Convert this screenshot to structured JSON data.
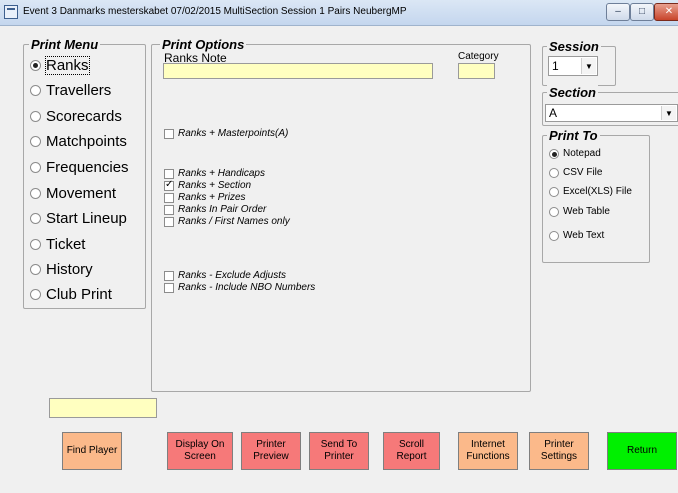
{
  "window": {
    "title": "Event 3   Danmarks mesterskabet 07/02/2015 MultiSection Session 1 Pairs NeubergMP",
    "minimize_glyph": "–",
    "maximize_glyph": "□",
    "close_glyph": "✕"
  },
  "print_menu": {
    "legend": "Print Menu",
    "items": [
      {
        "label": "Ranks",
        "selected": true
      },
      {
        "label": "Travellers",
        "selected": false
      },
      {
        "label": "Scorecards",
        "selected": false
      },
      {
        "label": "Matchpoints",
        "selected": false
      },
      {
        "label": "Frequencies",
        "selected": false
      },
      {
        "label": "Movement",
        "selected": false
      },
      {
        "label": "Start Lineup",
        "selected": false
      },
      {
        "label": "Ticket",
        "selected": false
      },
      {
        "label": "History",
        "selected": false
      },
      {
        "label": "Club Print",
        "selected": false
      }
    ]
  },
  "print_options": {
    "legend": "Print Options",
    "ranks_note_label": "Ranks Note",
    "ranks_note_value": "",
    "category_label": "Category",
    "category_value": "",
    "options": [
      {
        "label": "Ranks + Masterpoints(A)",
        "checked": false
      },
      {
        "label": "Ranks + Handicaps",
        "checked": false
      },
      {
        "label": "Ranks + Section",
        "checked": true
      },
      {
        "label": "Ranks + Prizes",
        "checked": false
      },
      {
        "label": "Ranks In Pair Order",
        "checked": false
      },
      {
        "label": "Ranks / First Names only",
        "checked": false
      },
      {
        "label": "Ranks - Exclude Adjusts",
        "checked": false
      },
      {
        "label": "Ranks - Include NBO Numbers",
        "checked": false
      }
    ]
  },
  "session": {
    "legend": "Session",
    "value": "1"
  },
  "section": {
    "legend": "Section",
    "value": "A"
  },
  "print_to": {
    "legend": "Print To",
    "items": [
      {
        "label": "Notepad",
        "selected": true
      },
      {
        "label": "CSV File",
        "selected": false
      },
      {
        "label": "Excel(XLS) File",
        "selected": false
      },
      {
        "label": "Web Table",
        "selected": false
      },
      {
        "label": "Web Text",
        "selected": false
      }
    ]
  },
  "find_player_input": "",
  "buttons": {
    "find_player": "Find Player",
    "display_on_screen": "Display On\nScreen",
    "printer_preview": "Printer\nPreview",
    "send_to_printer": "Send To\nPrinter",
    "scroll_report": "Scroll\nReport",
    "internet_functions": "Internet\nFunctions",
    "printer_settings": "Printer\nSettings",
    "return": "Return"
  },
  "colors": {
    "orange_button": "#fbb98a",
    "red_button": "#f67979",
    "green_button": "#00f000",
    "input_yellow": "#ffffc0"
  },
  "icons": {
    "app": "app-window-icon",
    "dropdown": "chevron-down-icon"
  }
}
